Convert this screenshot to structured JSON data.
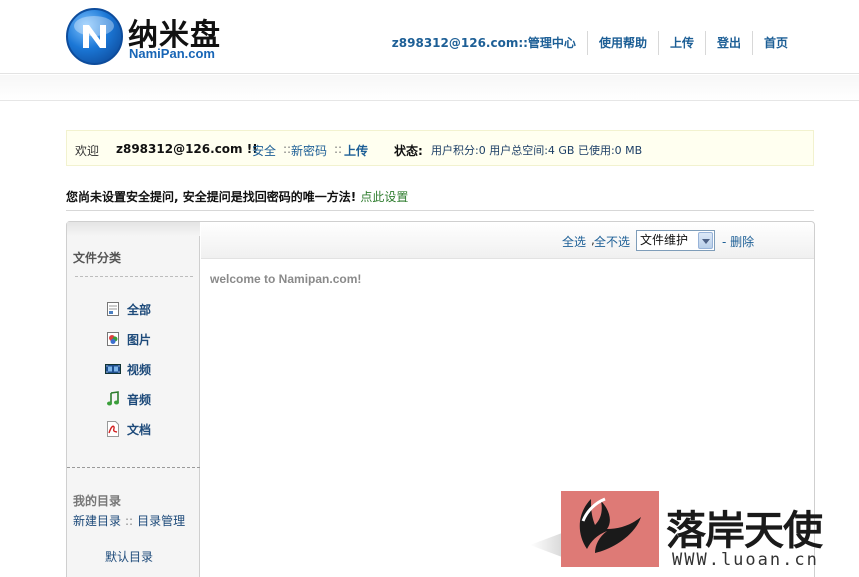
{
  "brand": {
    "name_cn": "纳米盘",
    "name_en": "NamiPan.com",
    "logo_icon": "namipan-logo-icon"
  },
  "topnav": {
    "account": "z898312@126.com::管理中心",
    "help": "使用帮助",
    "upload": "上传",
    "logout": "登出",
    "home": "首页"
  },
  "infobar": {
    "welcome": "欢迎",
    "user": "z898312@126.com !!",
    "safe": "安全",
    "sep": "::",
    "new_password": "新密码",
    "upload": "上传",
    "status_label": "状态:",
    "stats": "用户积分:0 用户总空间:4 GB 已使用:0 MB"
  },
  "warning": {
    "text": "您尚未设置安全提问, 安全提问是找回密码的唯一方法!",
    "link": "点此设置"
  },
  "sidebar": {
    "title": "文件分类",
    "categories": [
      {
        "label": "全部",
        "icon": "all-files-icon"
      },
      {
        "label": "图片",
        "icon": "image-icon"
      },
      {
        "label": "视频",
        "icon": "video-icon"
      },
      {
        "label": "音频",
        "icon": "audio-icon"
      },
      {
        "label": "文档",
        "icon": "document-icon"
      }
    ],
    "my_dirs_title": "我的目录",
    "new_dir": "新建目录",
    "dir_sep": "::",
    "manage_dir": "目录管理",
    "default_dir": "默认目录"
  },
  "toolbar": {
    "select_all": "全选",
    "comma": ",",
    "select_none": "全不选",
    "action_selected": "文件维护",
    "delete": "- 删除"
  },
  "content": {
    "welcome": "welcome to Namipan.com!"
  },
  "watermark": {
    "text": "落岸天使",
    "url": "WWW.luoan.cn"
  },
  "colors": {
    "link": "#1d5f96",
    "green_link": "#2f7d2f",
    "info_bg": "#fffff0",
    "watermark_red": "#de7a76"
  }
}
